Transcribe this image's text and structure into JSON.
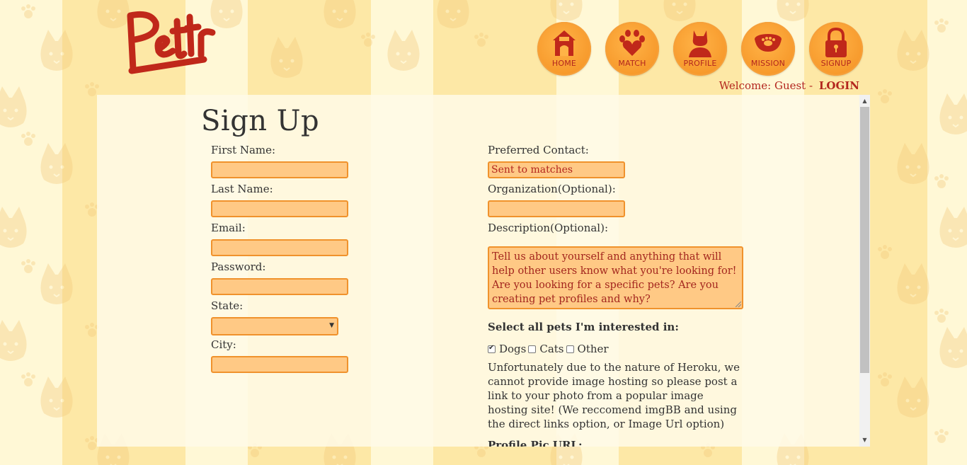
{
  "app": {
    "logo_text": "Pettr"
  },
  "nav": {
    "items": [
      {
        "label": "HOME",
        "icon": "doghouse-icon"
      },
      {
        "label": "MATCH",
        "icon": "paw-heart-icon"
      },
      {
        "label": "PROFILE",
        "icon": "cat-silhouette-icon"
      },
      {
        "label": "MISSION",
        "icon": "pet-bowl-icon"
      },
      {
        "label": "SIGNUP",
        "icon": "padlock-icon"
      }
    ]
  },
  "header": {
    "welcome_text": "Welcome: Guest",
    "separator": "-",
    "login_label": "LOGIN"
  },
  "form": {
    "title": "Sign Up",
    "left": {
      "first_name_label": "First Name:",
      "first_name_value": "",
      "last_name_label": "Last Name:",
      "last_name_value": "",
      "email_label": "Email:",
      "email_value": "",
      "password_label": "Password:",
      "password_value": "",
      "state_label": "State:",
      "state_value": "",
      "city_label": "City:",
      "city_value": ""
    },
    "right": {
      "preferred_contact_label": "Preferred Contact:",
      "preferred_contact_value": "Sent to matches",
      "organization_label": "Organization(Optional):",
      "organization_value": "",
      "description_label": "Description(Optional):",
      "description_placeholder": "Tell us about yourself and anything that will help other users know what you're looking for! Are you looking for a specific pets? Are you creating pet profiles and why?",
      "pets_label": "Select all pets I'm interested in:",
      "pets": [
        {
          "label": "Dogs",
          "checked": true
        },
        {
          "label": "Cats",
          "checked": false
        },
        {
          "label": "Other",
          "checked": false
        }
      ],
      "image_note": "Unfortunately due to the nature of Heroku, we cannot provide image hosting so please post a link to your photo from a popular image hosting site! (We reccomend imgBB and using the direct links option, or Image Url option)",
      "profile_pic_label": "Profile Pic URL:"
    }
  },
  "colors": {
    "accent_red": "#b3261e",
    "input_fill": "#ffc985",
    "input_border": "#f0922c",
    "nav_orange": "#f79a2c"
  }
}
